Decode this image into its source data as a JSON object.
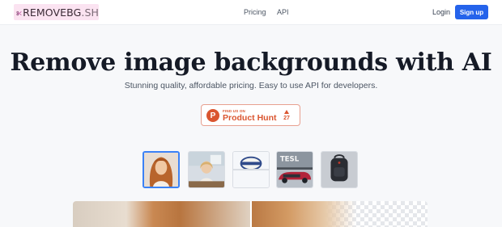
{
  "header": {
    "logo": {
      "main": "REMOVEBG",
      "suffix": ".SH"
    },
    "nav": [
      {
        "label": "Pricing"
      },
      {
        "label": "API"
      }
    ],
    "login_label": "Login",
    "signup_label": "Sign up"
  },
  "hero": {
    "title": "Remove image backgrounds with AI",
    "subtitle": "Stunning quality, affordable pricing. Easy to use API for developers."
  },
  "product_hunt": {
    "find_label": "FIND US ON",
    "name": "Product Hunt",
    "letter": "P",
    "votes": "27"
  },
  "thumbnails": [
    {
      "name": "woman-red-hair",
      "selected": true
    },
    {
      "name": "woman-desk"
    },
    {
      "name": "logo-sticker"
    },
    {
      "name": "tesla-car"
    },
    {
      "name": "backpack"
    }
  ],
  "colors": {
    "accent": "#2563eb",
    "product_hunt": "#da552f",
    "selected_border": "#3b82f6"
  }
}
